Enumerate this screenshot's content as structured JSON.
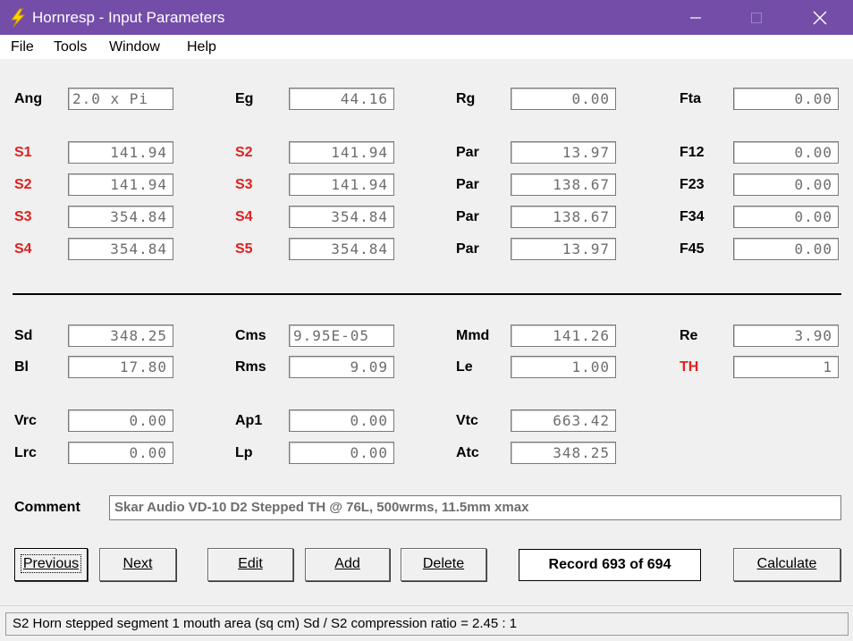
{
  "window": {
    "title": "Hornresp - Input Parameters"
  },
  "menu": [
    "File",
    "Tools",
    "Window",
    "Help"
  ],
  "params": {
    "ang": {
      "label": "Ang",
      "value": "2.0 x Pi"
    },
    "eg": {
      "label": "Eg",
      "value": "44.16"
    },
    "rg": {
      "label": "Rg",
      "value": "0.00"
    },
    "fta": {
      "label": "Fta",
      "value": "0.00"
    },
    "row1": {
      "l1": "S1",
      "v1": "141.94",
      "l2": "S2",
      "v2": "141.94",
      "l3": "Par",
      "v3": "13.97",
      "l4": "F12",
      "v4": "0.00"
    },
    "row2": {
      "l1": "S2",
      "v1": "141.94",
      "l2": "S3",
      "v2": "141.94",
      "l3": "Par",
      "v3": "138.67",
      "l4": "F23",
      "v4": "0.00"
    },
    "row3": {
      "l1": "S3",
      "v1": "354.84",
      "l2": "S4",
      "v2": "354.84",
      "l3": "Par",
      "v3": "138.67",
      "l4": "F34",
      "v4": "0.00"
    },
    "row4": {
      "l1": "S4",
      "v1": "354.84",
      "l2": "S5",
      "v2": "354.84",
      "l3": "Par",
      "v3": "13.97",
      "l4": "F45",
      "v4": "0.00"
    },
    "sd": {
      "label": "Sd",
      "value": "348.25"
    },
    "cms": {
      "label": "Cms",
      "value": "9.95E-05"
    },
    "mmd": {
      "label": "Mmd",
      "value": "141.26"
    },
    "re": {
      "label": "Re",
      "value": "3.90"
    },
    "bl": {
      "label": "Bl",
      "value": "17.80"
    },
    "rms": {
      "label": "Rms",
      "value": "9.09"
    },
    "le": {
      "label": "Le",
      "value": "1.00"
    },
    "th": {
      "label": "TH",
      "value": "1"
    },
    "vrc": {
      "label": "Vrc",
      "value": "0.00"
    },
    "ap1": {
      "label": "Ap1",
      "value": "0.00"
    },
    "vtc": {
      "label": "Vtc",
      "value": "663.42"
    },
    "lrc": {
      "label": "Lrc",
      "value": "0.00"
    },
    "lp": {
      "label": "Lp",
      "value": "0.00"
    },
    "atc": {
      "label": "Atc",
      "value": "348.25"
    }
  },
  "comment": {
    "label": "Comment",
    "value": "Skar Audio VD-10 D2 Stepped TH @ 76L, 500wrms, 11.5mm xmax"
  },
  "buttons": {
    "previous": "Previous",
    "next": "Next",
    "edit": "Edit",
    "add": "Add",
    "delete": "Delete",
    "calculate": "Calculate"
  },
  "record": "Record 693 of 694",
  "status": "S2   Horn stepped segment 1 mouth area  (sq cm)   Sd / S2 compression ratio = 2.45 : 1",
  "colors": {
    "titlebar": "#744da9",
    "label_red": "#e21f1f",
    "field_text": "#6d6d6d"
  },
  "icons": {
    "app": "lightning-bolt-icon",
    "minimize": "minimize-icon",
    "maximize": "maximize-icon",
    "close": "close-icon"
  }
}
